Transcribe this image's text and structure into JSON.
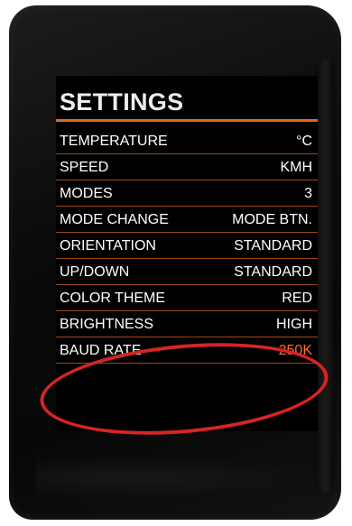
{
  "screen": {
    "title": "SETTINGS",
    "accent_color": "#d96a24",
    "highlight_value_color": "#ff6b2a"
  },
  "settings": [
    {
      "label": "TEMPERATURE",
      "value": "°C"
    },
    {
      "label": "SPEED",
      "value": "KMH"
    },
    {
      "label": "MODES",
      "value": "3"
    },
    {
      "label": "MODE CHANGE",
      "value": "MODE BTN."
    },
    {
      "label": "ORIENTATION",
      "value": "STANDARD"
    },
    {
      "label": "UP/DOWN",
      "value": "STANDARD"
    },
    {
      "label": "COLOR THEME",
      "value": "RED"
    },
    {
      "label": "BRIGHTNESS",
      "value": "HIGH"
    },
    {
      "label": "BAUD RATE",
      "value": "250K"
    }
  ],
  "annotation": {
    "color": "#d62424",
    "target": "BAUD RATE"
  }
}
